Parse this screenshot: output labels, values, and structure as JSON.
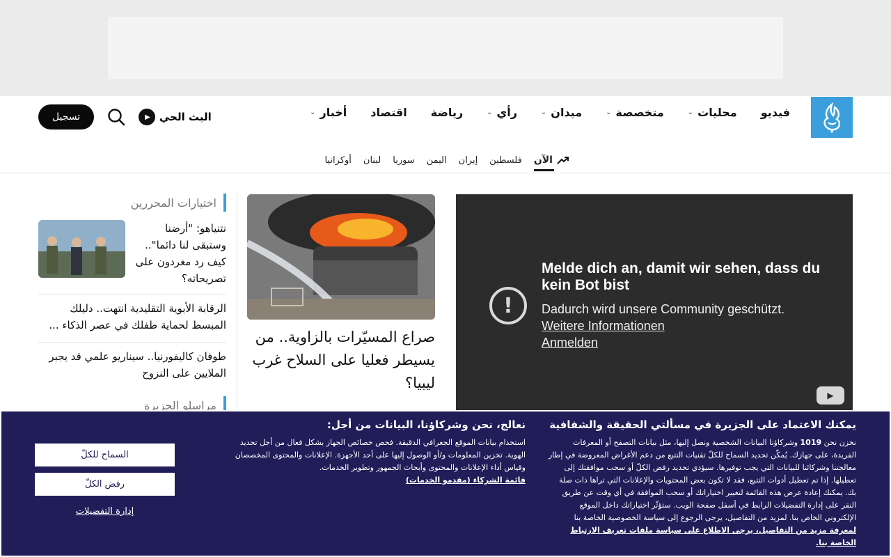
{
  "header": {
    "logo_alt": "الجزيرة",
    "nav": [
      {
        "label": "أخبار",
        "has_dropdown": true
      },
      {
        "label": "اقتصاد",
        "has_dropdown": false
      },
      {
        "label": "رياضة",
        "has_dropdown": false
      },
      {
        "label": "رأي",
        "has_dropdown": true
      },
      {
        "label": "ميدان",
        "has_dropdown": true
      },
      {
        "label": "متخصصة",
        "has_dropdown": true
      },
      {
        "label": "محليات",
        "has_dropdown": true
      },
      {
        "label": "فيديو",
        "has_dropdown": false
      }
    ],
    "live_label": "البث الحي",
    "register_label": "تسجيل",
    "subnav": {
      "now_label": "الآن",
      "items": [
        "فلسطين",
        "إيران",
        "اليمن",
        "سوريا",
        "لبنان",
        "أوكرانيا"
      ]
    }
  },
  "video": {
    "title": "Melde dich an, damit wir sehen, dass du kein Bot bist",
    "subtitle": "Dadurch wird unsere Community geschützt.",
    "more_info": "Weitere Informationen",
    "signin": "Anmelden"
  },
  "feature": {
    "title": "صراع المسيّرات بالزاوية.. من يسيطر فعليا على السلاح غرب ليبيا؟"
  },
  "editors_picks": {
    "heading": "اختيارات المحررين",
    "items": [
      {
        "title": "نتنياهو: \"أرضنا وستبقى لنا دائما\".. كيف رد مغردون على تصريحاته؟"
      },
      {
        "title": "الرقابة الأبوية التقليدية انتهت.. دليلك المبسط لحماية طفلك في عصر الذكاء ..."
      },
      {
        "title": "طوفان كاليفورنيا.. سيناريو علمي قد يجبر الملايين على النزوح"
      }
    ],
    "next_heading": "مراسلو الجزيرة"
  },
  "cookie": {
    "right_heading": "يمكنك الاعتماد على الجزيرة في مسألتي الحقيقة والشفافية",
    "right_text_before": "نخزن نحن",
    "partner_count": "1019",
    "right_text_after": "وشركاؤنا البيانات الشخصية ونصل إليها، مثل بيانات التصفح أو المعرفات الفريدة، على جهازك. يُمكّن تحديد السماح للكلّ تقنيات التتبع من دعم الأغراض المعروضة في إطار معالجتنا وشركائنا للبيانات التي يجب توفيرها. سيؤدي تحديد رفض الكلّ أو سحب موافقتك إلى تعطيلها. إذا تم تعطيل أدوات التتبع، فقد لا تكون بعض المحتويات والإعلانات التي تراها ذات صلة بك. يمكنك إعادة عرض هذه القائمة لتغيير اختياراتك أو سحب الموافقة في أي وقت عن طريق النقر على إدارة التفضيلات الرابط في أسفل صفحة الويب. ستؤثّر اختياراتك داخل الموقع الإلكتروني الخاص بنا. لمزيد من التفاصيل، يرجى الرجوع إلى سياسة الخصوصية الخاصة بنا",
    "right_link": "لمعرفة مزيد من التفاصيل، يرجى الاطلاع على سياسة ملفات تعريف الارتباط الخاصة بنا.",
    "mid_heading": "نعالج، نحن وشركاؤنا، البيانات من أجل:",
    "mid_text": "استخدام بيانات الموقع الجغرافي الدقيقة. فحص خصائص الجهاز بشكل فعال من أجل تحديد الهوية. تخزين المعلومات و/أو الوصول إليها على أحد الأجهزة. الإعلانات والمحتوى المخصصان وقياس أداء الإعلانات والمحتوى وأبحاث الجمهور وتطوير الخدمات.",
    "mid_link": "قائمة الشركاء (مقدمو الخدمات)",
    "allow_all": "السماح للكلّ",
    "reject_all": "رفض الكلّ",
    "manage_prefs": "إدارة التفضيلات"
  },
  "colors": {
    "brand_blue": "#3a9fdc",
    "cookie_bg": "#211d59",
    "video_bg": "#2c2c2c"
  }
}
